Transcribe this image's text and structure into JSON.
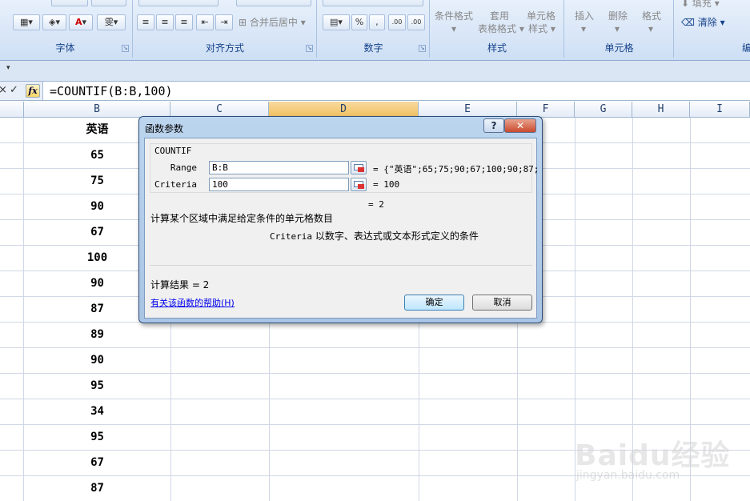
{
  "ribbon": {
    "groups": [
      {
        "label": "字体"
      },
      {
        "label": "对齐方式"
      },
      {
        "label": "数字"
      },
      {
        "label": "样式"
      },
      {
        "label": "单元格"
      },
      {
        "label": "编辑"
      }
    ],
    "merge_center": "合并后居中",
    "cond_format": "条件格式",
    "table_format_1": "套用",
    "table_format_2": "表格格式",
    "cell_style_1": "单元格",
    "cell_style_2": "样式",
    "insert": "插入",
    "delete": "删除",
    "format": "格式",
    "fill": "填充",
    "clear": "清除",
    "percent": "%",
    "comma": ",",
    "dec_inc": ".00",
    "dec_dec": ".00",
    "wen_btn": "雯"
  },
  "formula_bar": {
    "fx_label": "fx",
    "formula": "=COUNTIF(B:B,100)"
  },
  "columns": [
    "B",
    "C",
    "D",
    "E",
    "F",
    "G",
    "H",
    "I"
  ],
  "selected_column": "D",
  "column_b": [
    "英语",
    "65",
    "75",
    "90",
    "67",
    "100",
    "90",
    "87",
    "89",
    "90",
    "95",
    "34",
    "95",
    "67",
    "87"
  ],
  "dialog": {
    "title": "函数参数",
    "function_name": "COUNTIF",
    "args": [
      {
        "label": "Range",
        "value": "B:B",
        "result": "= {\"英语\";65;75;90;67;100;90;87;"
      },
      {
        "label": "Criteria",
        "value": "100",
        "result": "= 100"
      }
    ],
    "total": "= 2",
    "description": "计算某个区域中满足给定条件的单元格数目",
    "arg_help_name": "Criteria",
    "arg_help_text": "以数字、表达式或文本形式定义的条件",
    "calc_result": "计算结果 = 2",
    "help_link": "有关该函数的帮助(H)",
    "ok": "确定",
    "cancel": "取消",
    "help_icon": "?",
    "close_icon": "✕"
  },
  "watermark": {
    "main": "Baidu经验",
    "sub": "jingyan.baidu.com"
  },
  "colors": {
    "ribbon_text": "#15428b",
    "selected_header": "#f1c15f",
    "link": "#0000ee"
  }
}
